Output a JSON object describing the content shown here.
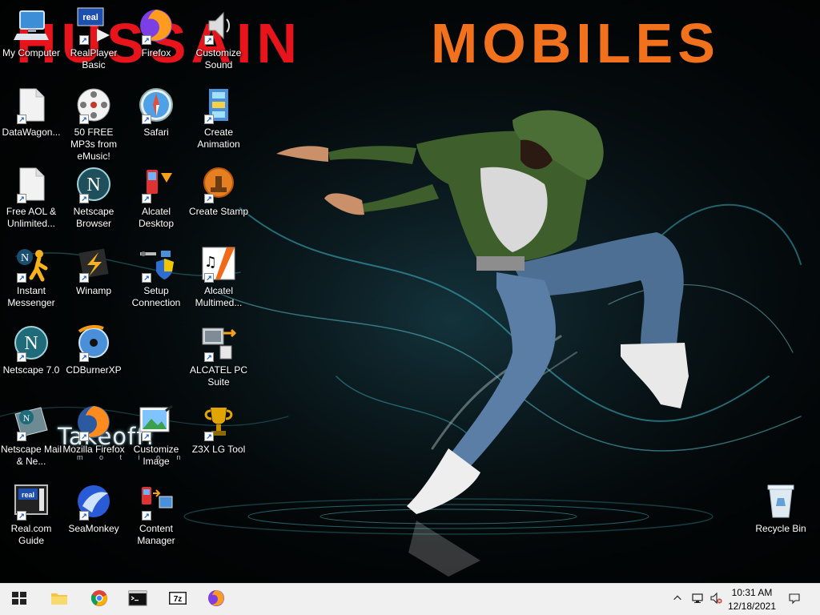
{
  "wallpaper": {
    "banner_left": "HUSSAIN",
    "banner_right": "MOBILES",
    "overlay_text": "Takeoff!",
    "overlay_subtext": "m o t i o n"
  },
  "desktop_icons": [
    {
      "name": "my-computer",
      "label": "My Computer",
      "icon": "computer-icon"
    },
    {
      "name": "realplayer-basic",
      "label": "RealPlayer Basic",
      "icon": "realplayer-icon"
    },
    {
      "name": "firefox",
      "label": "Firefox",
      "icon": "firefox-icon"
    },
    {
      "name": "customize-sound",
      "label": "Customize Sound",
      "icon": "speaker-icon"
    },
    {
      "name": "datawagon",
      "label": "DataWagon...",
      "icon": "document-icon"
    },
    {
      "name": "free-mp3s",
      "label": "50 FREE MP3s from eMusic!",
      "icon": "film-reel-icon"
    },
    {
      "name": "safari",
      "label": "Safari",
      "icon": "compass-icon"
    },
    {
      "name": "create-animation",
      "label": "Create Animation",
      "icon": "filmstrip-icon"
    },
    {
      "name": "free-aol",
      "label": "Free AOL & Unlimited...",
      "icon": "document-icon"
    },
    {
      "name": "netscape-browser",
      "label": "Netscape Browser",
      "icon": "netscape-icon"
    },
    {
      "name": "alcatel-desktop",
      "label": "Alcatel Desktop",
      "icon": "phone-icon"
    },
    {
      "name": "create-stamp",
      "label": "Create Stamp",
      "icon": "stamp-icon"
    },
    {
      "name": "instant-messenger",
      "label": "Instant Messenger",
      "icon": "aim-icon"
    },
    {
      "name": "winamp",
      "label": "Winamp",
      "icon": "winamp-icon"
    },
    {
      "name": "setup-connection",
      "label": "Setup Connection",
      "icon": "network-shield-icon"
    },
    {
      "name": "alcatel-multimedia",
      "label": "Alcatel Multimed...",
      "icon": "music-notes-icon"
    },
    {
      "name": "netscape-7",
      "label": "Netscape 7.0",
      "icon": "netscape-icon"
    },
    {
      "name": "cdburnerxp",
      "label": "CDBurnerXP",
      "icon": "cd-icon"
    },
    {
      "name": "alcatel-pc-suite",
      "label": "ALCATEL PC Suite",
      "icon": "pc-sync-icon"
    },
    {
      "name": "netscape-mail",
      "label": "Netscape Mail & Ne...",
      "icon": "netscape-mail-icon"
    },
    {
      "name": "mozilla-firefox",
      "label": "Mozilla Firefox",
      "icon": "firefox-icon"
    },
    {
      "name": "customize-image",
      "label": "Customize Image",
      "icon": "image-edit-icon"
    },
    {
      "name": "z3x-lg-tool",
      "label": "Z3X LG Tool",
      "icon": "trophy-icon"
    },
    {
      "name": "real-com-guide",
      "label": "Real.com Guide",
      "icon": "realguide-icon"
    },
    {
      "name": "seamonkey",
      "label": "SeaMonkey",
      "icon": "seamonkey-icon"
    },
    {
      "name": "content-manager",
      "label": "Content Manager",
      "icon": "phone-sync-icon"
    },
    {
      "name": "recycle-bin",
      "label": "Recycle Bin",
      "icon": "recycle-bin-icon"
    }
  ],
  "taskbar": {
    "items": [
      {
        "name": "start",
        "icon": "windows-logo-icon"
      },
      {
        "name": "file-explorer",
        "icon": "folder-icon"
      },
      {
        "name": "chrome",
        "icon": "chrome-icon"
      },
      {
        "name": "terminal",
        "icon": "terminal-icon"
      },
      {
        "name": "7zip",
        "icon": "7zip-icon"
      },
      {
        "name": "firefox",
        "icon": "firefox-icon"
      }
    ],
    "tray": {
      "time": "10:31 AM",
      "date": "12/18/2021",
      "icons": [
        "chevron-up-icon",
        "network-icon",
        "volume-muted-icon",
        "notification-icon"
      ]
    }
  },
  "colors": {
    "banner_left": "#e8141b",
    "banner_right": "#f2711c",
    "taskbar_bg": "#f0f0f0"
  }
}
